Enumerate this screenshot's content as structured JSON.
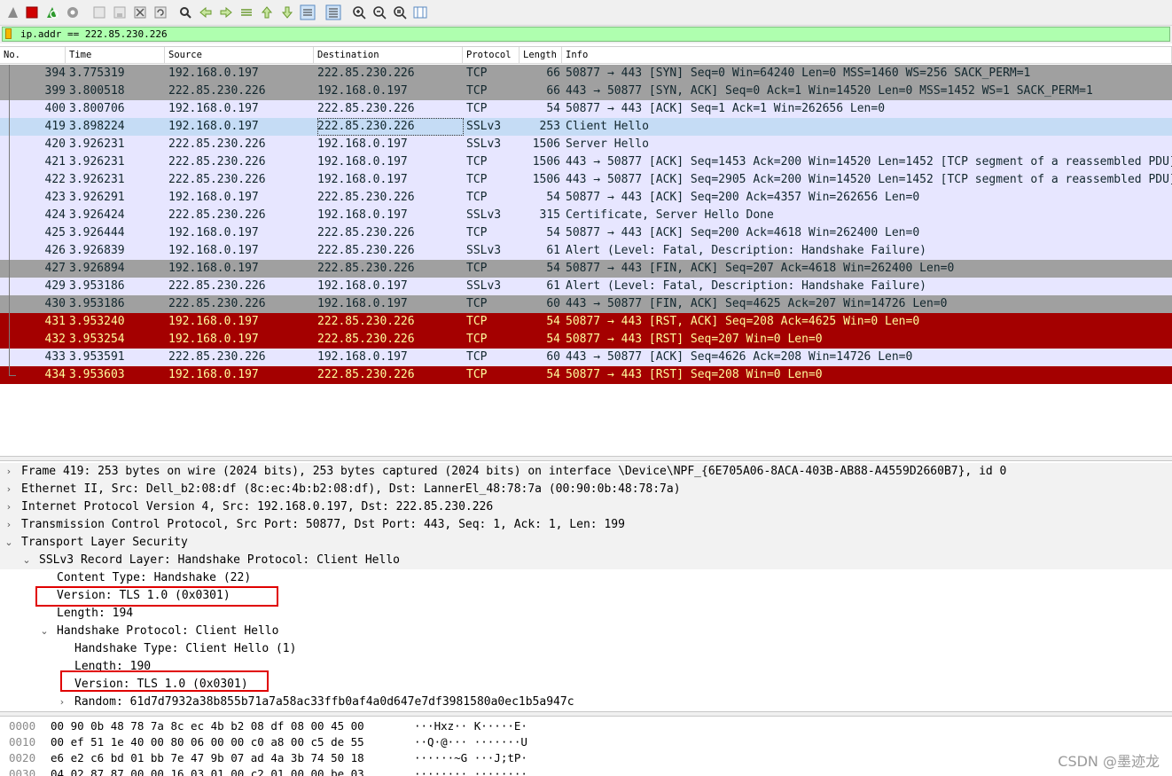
{
  "toolbar": {
    "icons": [
      "shark-fin-start-icon",
      "stop-capture-icon",
      "restart-capture-icon",
      "capture-options-icon",
      "open-file-icon",
      "save-file-icon",
      "close-file-icon",
      "reload-file-icon",
      "find-packet-icon",
      "go-back-icon",
      "go-forward-icon",
      "go-to-packet-icon",
      "go-first-packet-icon",
      "go-last-packet-icon",
      "autoscroll-icon",
      "colorize-icon",
      "zoom-in-icon",
      "zoom-out-icon",
      "normal-size-icon",
      "resize-columns-icon"
    ]
  },
  "filter": {
    "value": "ip.addr == 222.85.230.226"
  },
  "packet_list": {
    "columns": [
      "No.",
      "Time",
      "Source",
      "Destination",
      "Protocol",
      "Length",
      "Info"
    ],
    "rows": [
      {
        "no": "394",
        "time": "3.775319",
        "src": "192.168.0.197",
        "dst": "222.85.230.226",
        "proto": "TCP",
        "len": "66",
        "info": "50877 → 443 [SYN] Seq=0 Win=64240 Len=0 MSS=1460 WS=256 SACK_PERM=1",
        "bg": "#a0a0a0",
        "fg": "#12272e"
      },
      {
        "no": "399",
        "time": "3.800518",
        "src": "222.85.230.226",
        "dst": "192.168.0.197",
        "proto": "TCP",
        "len": "66",
        "info": "443 → 50877 [SYN, ACK] Seq=0 Ack=1 Win=14520 Len=0 MSS=1452 WS=1 SACK_PERM=1",
        "bg": "#a0a0a0",
        "fg": "#12272e"
      },
      {
        "no": "400",
        "time": "3.800706",
        "src": "192.168.0.197",
        "dst": "222.85.230.226",
        "proto": "TCP",
        "len": "54",
        "info": "50877 → 443 [ACK] Seq=1 Ack=1 Win=262656 Len=0",
        "bg": "#e7e6ff",
        "fg": "#12272e"
      },
      {
        "no": "419",
        "time": "3.898224",
        "src": "192.168.0.197",
        "dst": "222.85.230.226",
        "proto": "SSLv3",
        "len": "253",
        "info": "Client Hello",
        "bg": "#c5dcf5",
        "fg": "#12272e",
        "selected": true
      },
      {
        "no": "420",
        "time": "3.926231",
        "src": "222.85.230.226",
        "dst": "192.168.0.197",
        "proto": "SSLv3",
        "len": "1506",
        "info": "Server Hello",
        "bg": "#e7e6ff",
        "fg": "#12272e"
      },
      {
        "no": "421",
        "time": "3.926231",
        "src": "222.85.230.226",
        "dst": "192.168.0.197",
        "proto": "TCP",
        "len": "1506",
        "info": "443 → 50877 [ACK] Seq=1453 Ack=200 Win=14520 Len=1452 [TCP segment of a reassembled PDU]",
        "bg": "#e7e6ff",
        "fg": "#12272e"
      },
      {
        "no": "422",
        "time": "3.926231",
        "src": "222.85.230.226",
        "dst": "192.168.0.197",
        "proto": "TCP",
        "len": "1506",
        "info": "443 → 50877 [ACK] Seq=2905 Ack=200 Win=14520 Len=1452 [TCP segment of a reassembled PDU]",
        "bg": "#e7e6ff",
        "fg": "#12272e"
      },
      {
        "no": "423",
        "time": "3.926291",
        "src": "192.168.0.197",
        "dst": "222.85.230.226",
        "proto": "TCP",
        "len": "54",
        "info": "50877 → 443 [ACK] Seq=200 Ack=4357 Win=262656 Len=0",
        "bg": "#e7e6ff",
        "fg": "#12272e"
      },
      {
        "no": "424",
        "time": "3.926424",
        "src": "222.85.230.226",
        "dst": "192.168.0.197",
        "proto": "SSLv3",
        "len": "315",
        "info": "Certificate, Server Hello Done",
        "bg": "#e7e6ff",
        "fg": "#12272e"
      },
      {
        "no": "425",
        "time": "3.926444",
        "src": "192.168.0.197",
        "dst": "222.85.230.226",
        "proto": "TCP",
        "len": "54",
        "info": "50877 → 443 [ACK] Seq=200 Ack=4618 Win=262400 Len=0",
        "bg": "#e7e6ff",
        "fg": "#12272e"
      },
      {
        "no": "426",
        "time": "3.926839",
        "src": "192.168.0.197",
        "dst": "222.85.230.226",
        "proto": "SSLv3",
        "len": "61",
        "info": "Alert (Level: Fatal, Description: Handshake Failure)",
        "bg": "#e7e6ff",
        "fg": "#12272e"
      },
      {
        "no": "427",
        "time": "3.926894",
        "src": "192.168.0.197",
        "dst": "222.85.230.226",
        "proto": "TCP",
        "len": "54",
        "info": "50877 → 443 [FIN, ACK] Seq=207 Ack=4618 Win=262400 Len=0",
        "bg": "#a0a0a0",
        "fg": "#12272e"
      },
      {
        "no": "429",
        "time": "3.953186",
        "src": "222.85.230.226",
        "dst": "192.168.0.197",
        "proto": "SSLv3",
        "len": "61",
        "info": "Alert (Level: Fatal, Description: Handshake Failure)",
        "bg": "#e7e6ff",
        "fg": "#12272e"
      },
      {
        "no": "430",
        "time": "3.953186",
        "src": "222.85.230.226",
        "dst": "192.168.0.197",
        "proto": "TCP",
        "len": "60",
        "info": "443 → 50877 [FIN, ACK] Seq=4625 Ack=207 Win=14726 Len=0",
        "bg": "#a0a0a0",
        "fg": "#12272e"
      },
      {
        "no": "431",
        "time": "3.953240",
        "src": "192.168.0.197",
        "dst": "222.85.230.226",
        "proto": "TCP",
        "len": "54",
        "info": "50877 → 443 [RST, ACK] Seq=208 Ack=4625 Win=0 Len=0",
        "bg": "#a40000",
        "fg": "#fffc9c"
      },
      {
        "no": "432",
        "time": "3.953254",
        "src": "192.168.0.197",
        "dst": "222.85.230.226",
        "proto": "TCP",
        "len": "54",
        "info": "50877 → 443 [RST] Seq=207 Win=0 Len=0",
        "bg": "#a40000",
        "fg": "#fffc9c"
      },
      {
        "no": "433",
        "time": "3.953591",
        "src": "222.85.230.226",
        "dst": "192.168.0.197",
        "proto": "TCP",
        "len": "60",
        "info": "443 → 50877 [ACK] Seq=4626 Ack=208 Win=14726 Len=0",
        "bg": "#e7e6ff",
        "fg": "#12272e"
      },
      {
        "no": "434",
        "time": "3.953603",
        "src": "192.168.0.197",
        "dst": "222.85.230.226",
        "proto": "TCP",
        "len": "54",
        "info": "50877 → 443 [RST] Seq=208 Win=0 Len=0",
        "bg": "#a40000",
        "fg": "#fffc9c"
      }
    ]
  },
  "details": {
    "rows": [
      {
        "text": "Frame 419: 253 bytes on wire (2024 bits), 253 bytes captured (2024 bits) on interface \\Device\\NPF_{6E705A06-8ACA-403B-AB88-A4559D2660B7}, id 0",
        "indent": 0,
        "arrow": "›"
      },
      {
        "text": "Ethernet II, Src: Dell_b2:08:df (8c:ec:4b:b2:08:df), Dst: LannerEl_48:78:7a (00:90:0b:48:78:7a)",
        "indent": 0,
        "arrow": "›"
      },
      {
        "text": "Internet Protocol Version 4, Src: 192.168.0.197, Dst: 222.85.230.226",
        "indent": 0,
        "arrow": "›"
      },
      {
        "text": "Transmission Control Protocol, Src Port: 50877, Dst Port: 443, Seq: 1, Ack: 1, Len: 199",
        "indent": 0,
        "arrow": "›"
      },
      {
        "text": "Transport Layer Security",
        "indent": 0,
        "arrow": "⌄"
      },
      {
        "text": "SSLv3 Record Layer: Handshake Protocol: Client Hello",
        "indent": 1,
        "arrow": "⌄"
      },
      {
        "text": "Content Type: Handshake (22)",
        "indent": 2,
        "arrow": ""
      },
      {
        "text": "Version: TLS 1.0 (0x0301)",
        "indent": 2,
        "arrow": ""
      },
      {
        "text": "Length: 194",
        "indent": 2,
        "arrow": ""
      },
      {
        "text": "Handshake Protocol: Client Hello",
        "indent": 2,
        "arrow": "⌄"
      },
      {
        "text": "Handshake Type: Client Hello (1)",
        "indent": 3,
        "arrow": ""
      },
      {
        "text": "Length: 190",
        "indent": 3,
        "arrow": ""
      },
      {
        "text": "Version: TLS 1.0 (0x0301)",
        "indent": 3,
        "arrow": ""
      },
      {
        "text": "Random: 61d7d7932a38b855b71a7a58ac33ffb0af4a0d647e7df3981580a0ec1b5a947c",
        "indent": 3,
        "arrow": "›"
      }
    ]
  },
  "bytes": {
    "rows": [
      {
        "offset": "0000",
        "hex": "00 90 0b 48 78 7a 8c ec  4b b2 08 df 08 00 45 00",
        "ascii": "···Hxz·· K·····E·"
      },
      {
        "offset": "0010",
        "hex": "00 ef 51 1e 40 00 80 06  00 00 c0 a8 00 c5 de 55",
        "ascii": "··Q·@··· ·······U"
      },
      {
        "offset": "0020",
        "hex": "e6 e2 c6 bd 01 bb 7e 47  9b 07 ad 4a 3b 74 50 18",
        "ascii": "······~G ···J;tP·"
      },
      {
        "offset": "0030",
        "hex": "04 02 87 87 00 00 16 03  01 00 c2 01 00 00 be 03",
        "ascii": "········ ········"
      }
    ]
  },
  "watermark": "CSDN @墨迹龙",
  "colors": {
    "selected_row": "#c5dcf5",
    "rst_row": "#a40000",
    "gray_row": "#a0a0a0",
    "default_row": "#e7e6ff",
    "filter_bg": "#afffaf",
    "highlight_box": "#e00000"
  }
}
